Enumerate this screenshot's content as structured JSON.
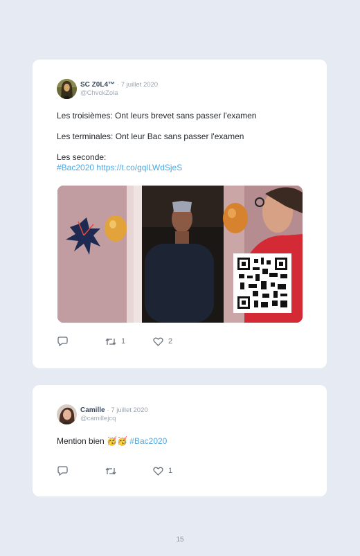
{
  "tweets": [
    {
      "name": "SC Z0L4™",
      "dot": "·",
      "date": "7 juillet 2020",
      "handle": "@ChvckZola",
      "lines": [
        "Les troisièmes: Ont leurs brevet sans passer l'examen",
        "Les terminales: Ont leur Bac sans passer l'examen",
        "Les seconde:"
      ],
      "hashtag": "#Bac2020",
      "url": "https://t.co/gqlLWdSjeS",
      "media_description": "video",
      "actions": {
        "reply": "",
        "retweet": "1",
        "like": "2"
      }
    },
    {
      "name": "Camille",
      "dot": "·",
      "date": "7 juillet 2020",
      "handle": "@camillejcq",
      "text": "Mention bien",
      "emoji": "🥳🥳",
      "hashtag": "#Bac2020",
      "actions": {
        "reply": "",
        "retweet": "",
        "like": "1"
      }
    }
  ],
  "page_number": "15",
  "colors": {
    "background": "#e6eaf2",
    "card": "#ffffff",
    "link": "#4aa8e6",
    "icons": "#69727d"
  }
}
